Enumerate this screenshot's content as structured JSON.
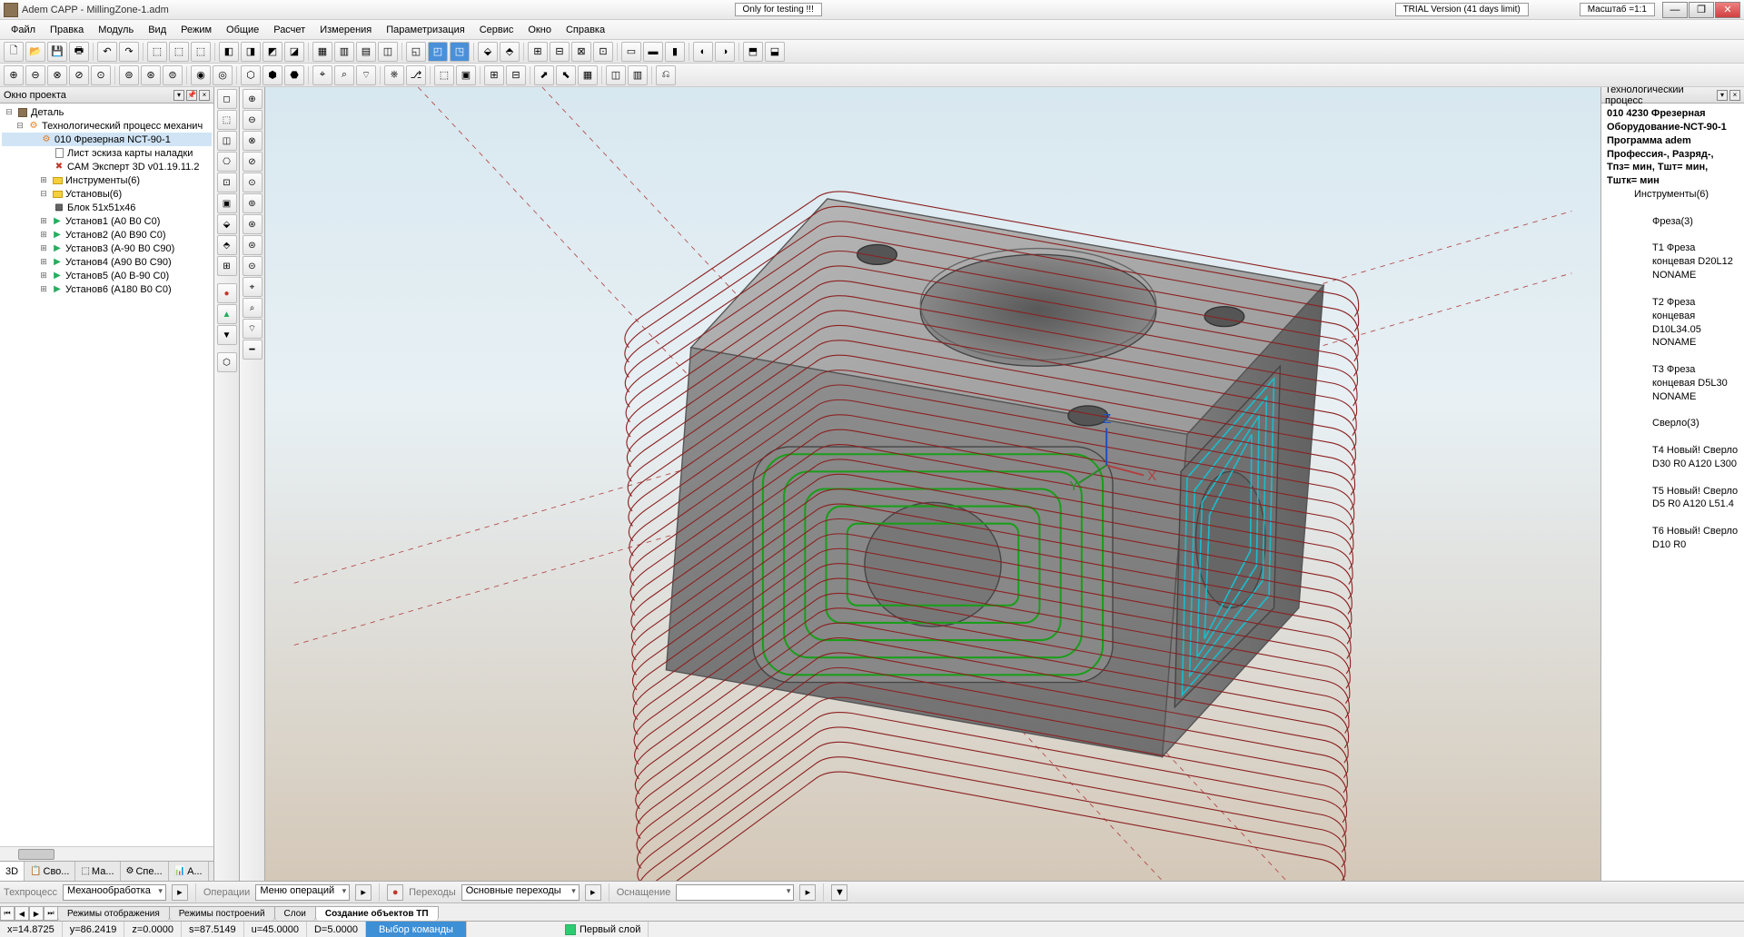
{
  "title": "Adem CAPP - MillingZone-1.adm",
  "banners": {
    "testing": "Only for testing !!!",
    "trial": "TRIAL Version (41 days limit)",
    "scale": "Масштаб =1:1"
  },
  "menu": [
    "Файл",
    "Правка",
    "Модуль",
    "Вид",
    "Режим",
    "Общие",
    "Расчет",
    "Измерения",
    "Параметризация",
    "Сервис",
    "Окно",
    "Справка"
  ],
  "left_panel": {
    "title": "Окно проекта",
    "tree": {
      "root": "Деталь",
      "process": "Технологический процесс механич",
      "op": "010  Фрезерная NCT-90-1",
      "items": [
        "Лист эскиза карты наладки",
        "САМ Эксперт 3D v01.19.11.2",
        "Инструменты(6)",
        "Установы(6)",
        "Блок 51x51x46",
        "Установ1 (A0 B0 C0)",
        "Установ2 (A0 B90 C0)",
        "Установ3 (A-90 B0 C90)",
        "Установ4 (A90 B0 C90)",
        "Установ5 (A0 B-90 C0)",
        "Установ6 (A180 B0 C0)"
      ]
    },
    "tabs": [
      "3D",
      "Сво...",
      "Ма...",
      "Спе...",
      "А..."
    ]
  },
  "right_panel": {
    "title": "Технологический процесс",
    "header": "010   4230 Фрезерная",
    "equipment": "Оборудование-NCT-90-1",
    "program": "Программа adem",
    "profession": "Профессия-,  Разряд-,",
    "times": "Тпз= мин,   Тшт= мин, Тштк= мин",
    "tools_header": "Инструменты(6)",
    "mill_header": "Фреза(3)",
    "tools_mill": [
      "T1 Фреза концевая D20L12 NONAME",
      "T2 Фреза концевая D10L34.05  NONAME",
      "T3 Фреза концевая D5L30 NONAME"
    ],
    "drill_header": "Сверло(3)",
    "tools_drill": [
      "T4 Новый! Сверло D30 R0 A120 L300",
      "T5 Новый! Сверло D5 R0 A120 L51.4",
      "T6 Новый! Сверло D10 R0"
    ]
  },
  "bottom": {
    "techprocess_label": "Техпроцесс",
    "techprocess_value": "Механообработка",
    "operations_label": "Операции",
    "operations_value": "Меню операций",
    "transitions_label": "Переходы",
    "transitions_value": "Основные переходы",
    "equipment_label": "Оснащение",
    "tabs": [
      "Режимы отображения",
      "Режимы построений",
      "Слои",
      "Создание объектов ТП"
    ]
  },
  "status": {
    "x": "x=14.8725",
    "y": "y=86.2419",
    "z": "z=0.0000",
    "s": "s=87.5149",
    "u": "u=45.0000",
    "d": "D=5.0000",
    "cmd": "Выбор команды",
    "layer": "Первый слой"
  },
  "axes": {
    "x": "X",
    "y": "Y",
    "z": "Z"
  }
}
